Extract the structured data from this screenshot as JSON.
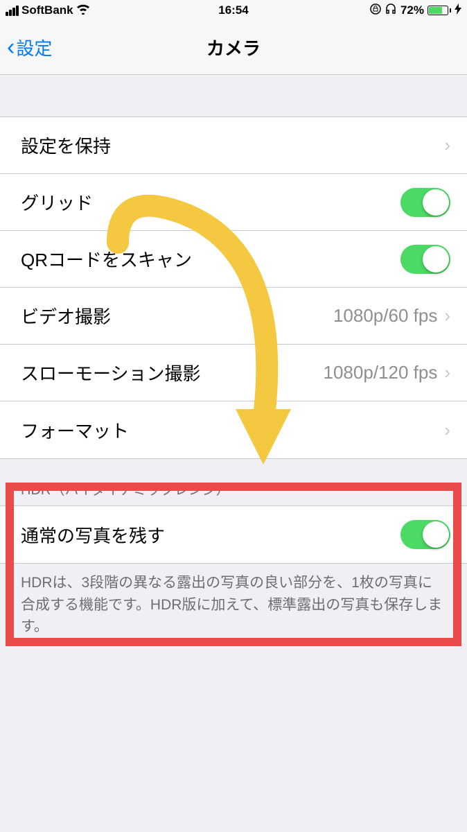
{
  "statusBar": {
    "carrier": "SoftBank",
    "time": "16:54",
    "batteryPercent": "72%"
  },
  "nav": {
    "back": "設定",
    "title": "カメラ"
  },
  "group1": {
    "preserve": "設定を保持",
    "grid": "グリッド",
    "qr": "QRコードをスキャン",
    "video": "ビデオ撮影",
    "videoValue": "1080p/60 fps",
    "slomo": "スローモーション撮影",
    "slomoValue": "1080p/120 fps",
    "format": "フォーマット"
  },
  "hdr": {
    "header": "HDR（ハイダイナミックレンジ）",
    "keepNormal": "通常の写真を残す",
    "footer": "HDRは、3段階の異なる露出の写真の良い部分を、1枚の写真に合成する機能です。HDR版に加えて、標準露出の写真も保存します。"
  }
}
